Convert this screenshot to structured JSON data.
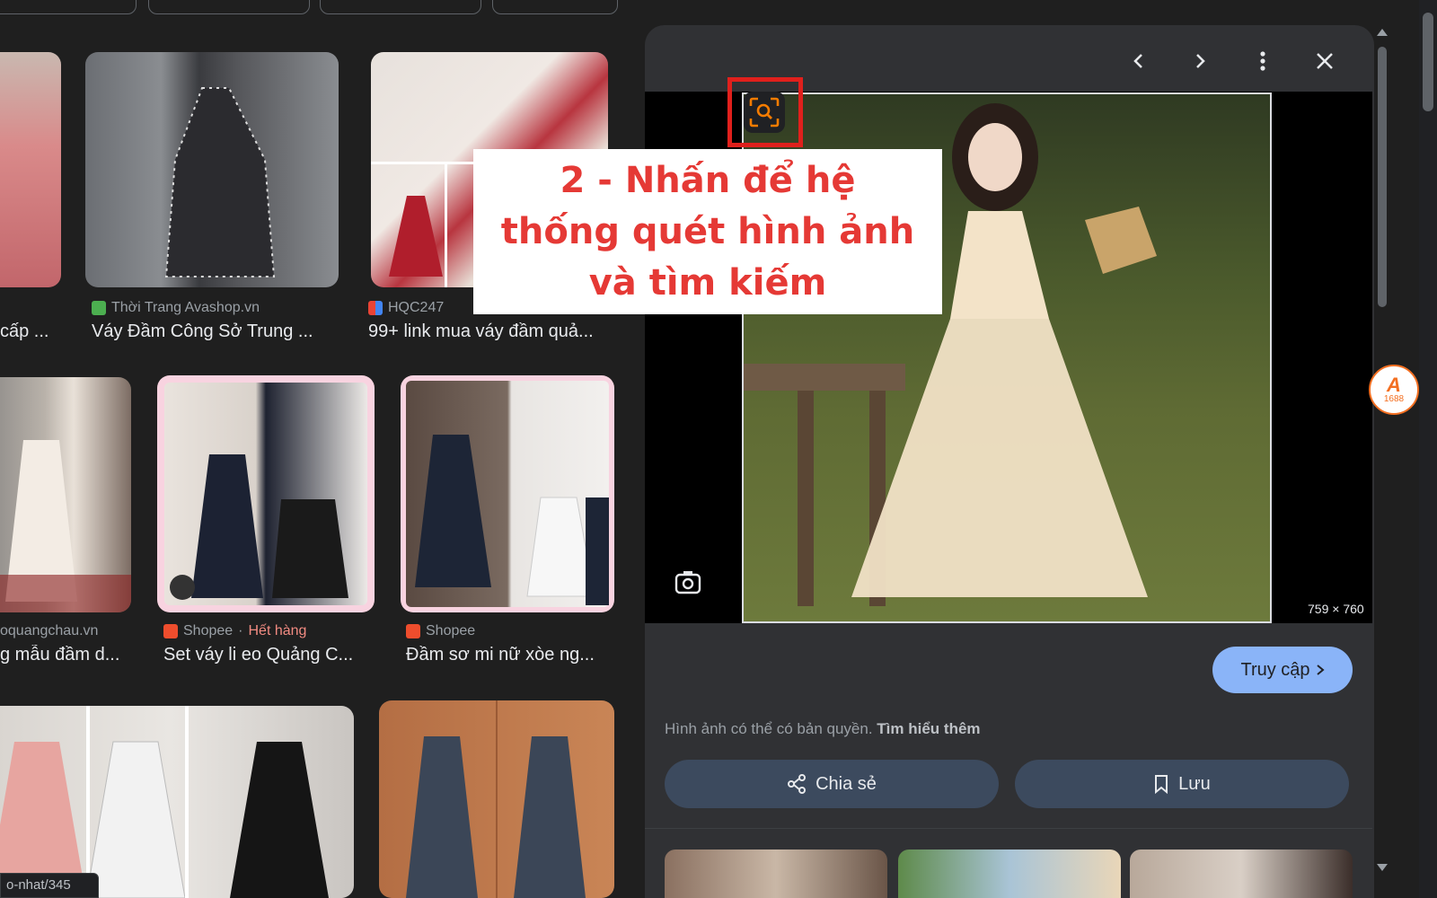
{
  "results": [
    {
      "source": "",
      "title": "cấp ..."
    },
    {
      "source": "Thời Trang Avashop.vn",
      "title": "Váy Đầm Công Sở Trung ..."
    },
    {
      "source": "HQC247",
      "title": "99+ link mua váy đầm quả..."
    },
    {
      "source": "oquangchau.vn",
      "title": "g mẫu đầm d..."
    },
    {
      "source": "Shopee",
      "badge": "Hết hàng",
      "title": "Set váy li eo Quảng C..."
    },
    {
      "source": "Shopee",
      "title": "Đầm sơ mi nữ xòe ng..."
    }
  ],
  "panel": {
    "image_dimensions": "759 × 760",
    "visit_label": "Truy cập",
    "copyright_text": "Hình ảnh có thể có bản quyền.",
    "learn_more": "Tìm hiểu thêm",
    "share_label": "Chia sẻ",
    "save_label": "Lưu"
  },
  "annotation": {
    "text": "2 - Nhấn để hệ thống quét hình ảnh và tìm kiếm"
  },
  "extension": {
    "line1": "A",
    "line2": "1688"
  },
  "status_bar": "o-nhat/345",
  "colors": {
    "accent": "#8ab4f8",
    "annotation_red": "#e53935",
    "panel_bg": "#303134"
  }
}
